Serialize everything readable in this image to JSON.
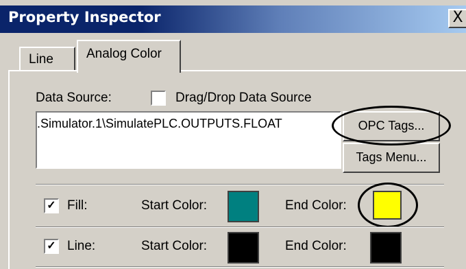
{
  "window": {
    "title": "Property Inspector",
    "close_symbol": "X"
  },
  "tabs": [
    {
      "label": "Line",
      "active": false
    },
    {
      "label": "Analog Color",
      "active": true
    }
  ],
  "data_source": {
    "label": "Data Source:",
    "dragdrop_label": "Drag/Drop Data Source",
    "dragdrop_checked": false,
    "value": ".Simulator.1\\SimulatePLC.OUTPUTS.FLOAT",
    "opc_button": "OPC Tags...",
    "tags_button": "Tags Menu..."
  },
  "fill": {
    "label": "Fill:",
    "checked": true,
    "check_symbol": "✓",
    "start_label": "Start Color:",
    "start_color": "#008080",
    "end_label": "End Color:",
    "end_color": "#ffff00"
  },
  "line": {
    "label": "Line:",
    "checked": true,
    "check_symbol": "✓",
    "start_label": "Start Color:",
    "start_color": "#000000",
    "end_label": "End Color:",
    "end_color": "#000000"
  }
}
